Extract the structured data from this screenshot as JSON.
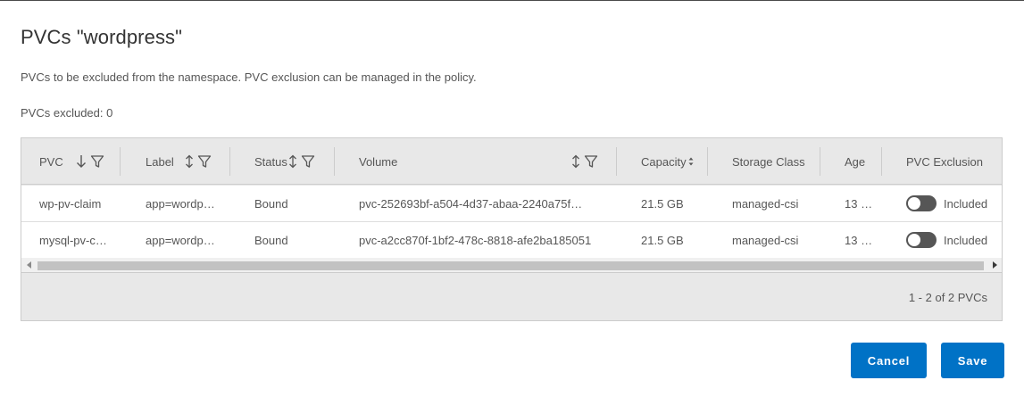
{
  "dialog": {
    "title": "PVCs \"wordpress\"",
    "description": "PVCs to be excluded from the namespace. PVC exclusion can be managed in the policy.",
    "excluded_text": "PVCs excluded: 0"
  },
  "table": {
    "columns": {
      "pvc": "PVC",
      "label": "Label",
      "status": "Status",
      "volume": "Volume",
      "capacity": "Capacity",
      "storage_class": "Storage Class",
      "age": "Age",
      "pvc_exclusion": "PVC Exclusion"
    },
    "rows": [
      {
        "pvc": "wp-pv-claim",
        "label": "app=wordp…",
        "status": "Bound",
        "volume": "pvc-252693bf-a504-4d37-abaa-2240a75f…",
        "capacity": "21.5 GB",
        "storage_class": "managed-csi",
        "age": "13 …",
        "exclusion_label": "Included"
      },
      {
        "pvc": "mysql-pv-c…",
        "label": "app=wordp…",
        "status": "Bound",
        "volume": "pvc-a2cc870f-1bf2-478c-8818-afe2ba185051",
        "capacity": "21.5 GB",
        "storage_class": "managed-csi",
        "age": "13 …",
        "exclusion_label": "Included"
      }
    ],
    "pagination": "1 - 2 of 2 PVCs"
  },
  "buttons": {
    "cancel": "Cancel",
    "save": "Save"
  },
  "colors": {
    "primary": "#0072c6",
    "header_bg": "#e8e8e8",
    "toggle_off": "#565656"
  }
}
